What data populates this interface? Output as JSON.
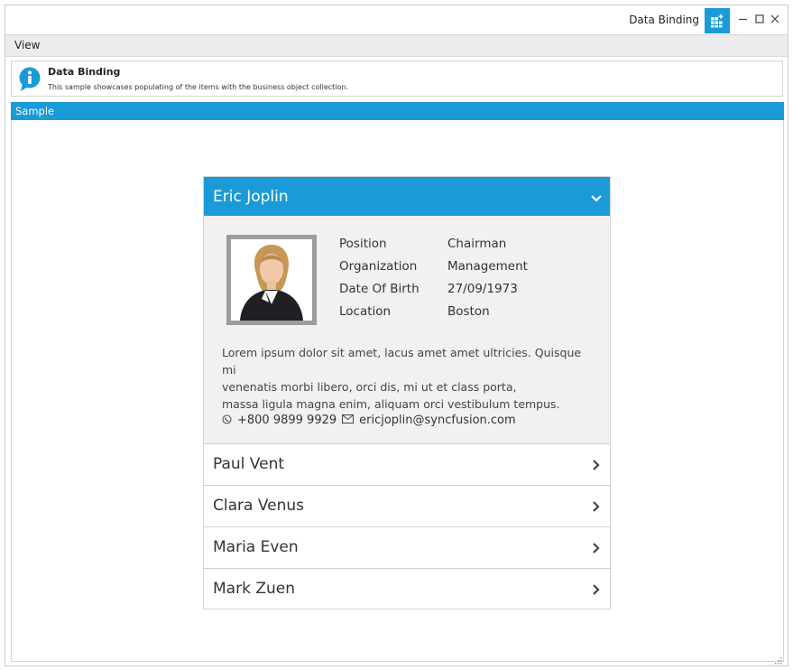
{
  "window": {
    "title": "Data Binding"
  },
  "menu": {
    "items": [
      {
        "label": "View"
      }
    ]
  },
  "info": {
    "title": "Data Binding",
    "description": "This sample showcases populating of the items with the business object collection."
  },
  "sample": {
    "label": "Sample"
  },
  "expanded_employee": {
    "name": "Eric Joplin",
    "details": [
      {
        "label": "Position",
        "value": "Chairman"
      },
      {
        "label": "Organization",
        "value": "Management"
      },
      {
        "label": "Date Of Birth",
        "value": "27/09/1973"
      },
      {
        "label": "Location",
        "value": "Boston"
      }
    ],
    "bio_lines": [
      "Lorem ipsum dolor sit amet, lacus amet amet ultricies. Quisque mi",
      "venenatis morbi libero, orci dis, mi ut et class porta,",
      "massa ligula magna enim, aliquam orci vestibulum tempus."
    ],
    "phone": "+800 9899 9929",
    "email": "ericjoplin@syncfusion.com"
  },
  "collapsed_employees": [
    {
      "name": "Paul Vent"
    },
    {
      "name": "Clara Venus"
    },
    {
      "name": "Maria Even"
    },
    {
      "name": "Mark Zuen"
    }
  ],
  "icons": {
    "app": "app-grid-icon",
    "minimize": "minimize-icon",
    "maximize": "maximize-icon",
    "close": "close-icon",
    "info": "info-icon",
    "phone": "phone-icon",
    "mail": "mail-icon",
    "expand": "chevron-down-icon",
    "collapse": "chevron-right-icon"
  },
  "colors": {
    "accent": "#1a9bd7",
    "card_body_bg": "#f2f1ef"
  }
}
